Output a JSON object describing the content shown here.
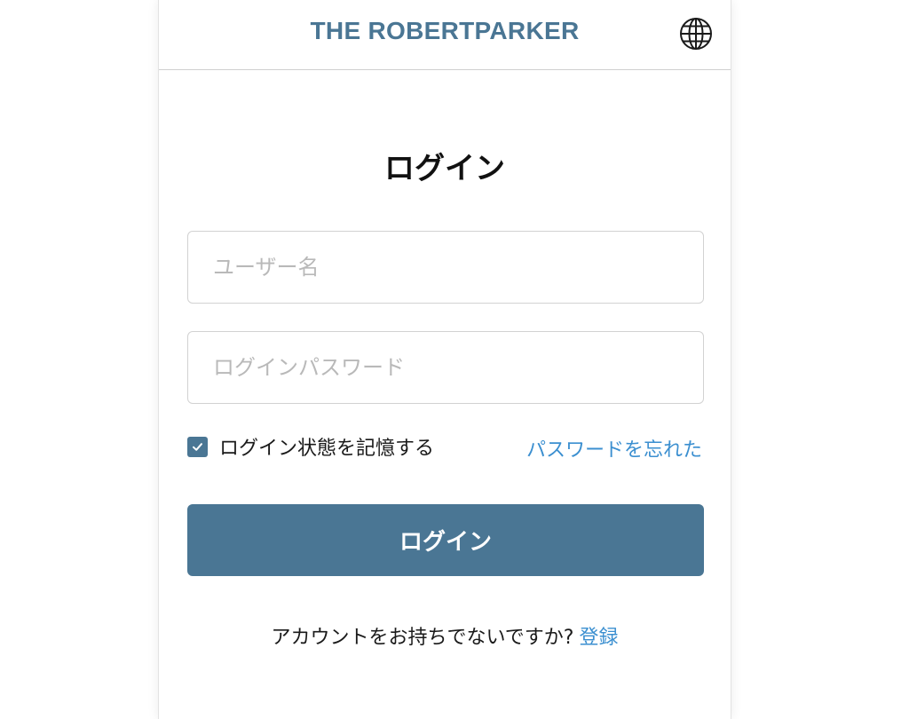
{
  "header": {
    "brand": "THE ROBERTPARKER",
    "language_icon": "globe-icon"
  },
  "login": {
    "title": "ログイン",
    "username_placeholder": "ユーザー名",
    "username_value": "",
    "password_placeholder": "ログインパスワード",
    "password_value": "",
    "remember_label": "ログイン状態を記憶する",
    "remember_checked": true,
    "forgot_label": "パスワードを忘れた",
    "submit_label": "ログイン",
    "no_account_text": "アカウントをお持ちでないですか?",
    "signup_label": "登録"
  },
  "colors": {
    "brand": "#4a7694",
    "link": "#3b8fd0",
    "placeholder": "#b9b9b9",
    "border": "#d2d2d2"
  }
}
